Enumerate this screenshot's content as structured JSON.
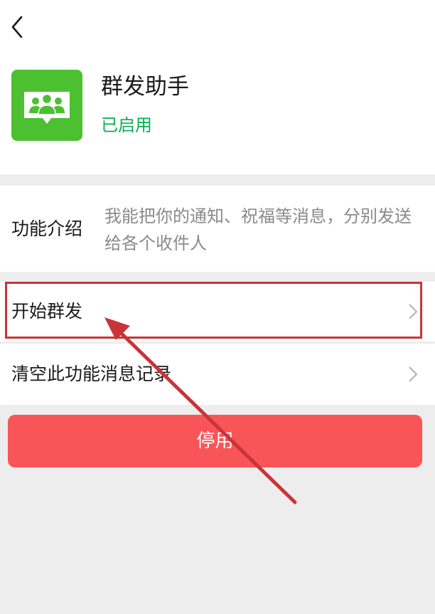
{
  "header": {
    "back_icon": "chevron-left-icon"
  },
  "app": {
    "icon": "group-chat-icon",
    "name": "群发助手",
    "status": "已启用",
    "status_color": "#07b050",
    "icon_color": "#4bc030"
  },
  "intro": {
    "label": "功能介绍",
    "text": "我能把你的通知、祝福等消息，分别发送给各个收件人"
  },
  "menu": [
    {
      "label": "开始群发",
      "icon": "chevron-right-icon"
    },
    {
      "label": "清空此功能消息记录",
      "icon": "chevron-right-icon"
    }
  ],
  "actions": {
    "disable_label": "停用",
    "disable_color": "#f95558"
  },
  "annotation": {
    "highlight_color": "#c8343a",
    "arrow_color": "#c8343a"
  }
}
